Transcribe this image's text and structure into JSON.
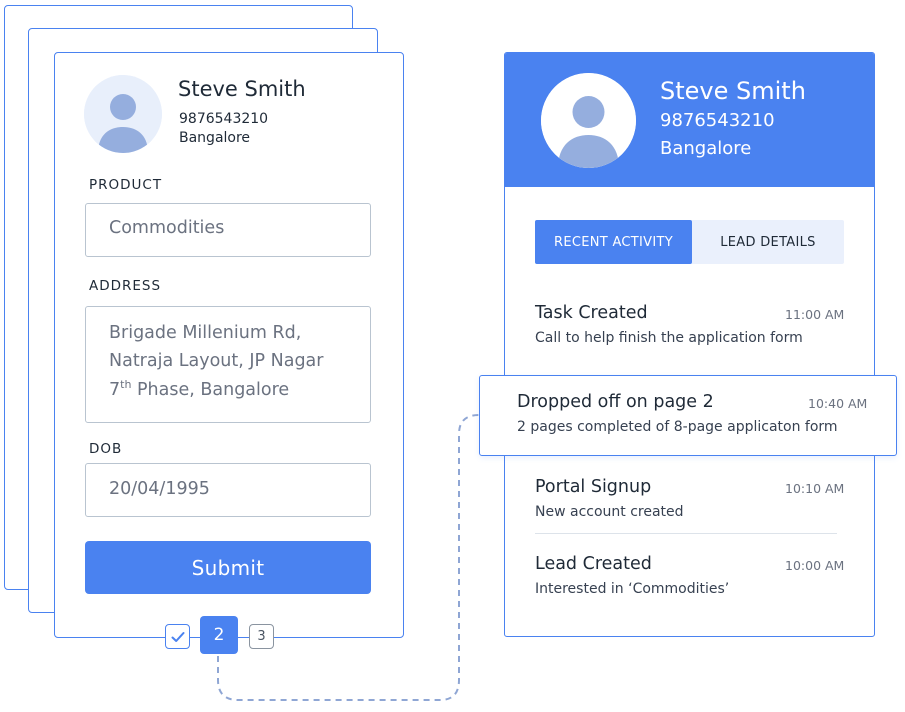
{
  "form": {
    "name": "Steve Smith",
    "phone": "9876543210",
    "city": "Bangalore",
    "product_label": "PRODUCT",
    "product_value": "Commodities",
    "address_label": "ADDRESS",
    "address_lines": [
      "Brigade Millenium Rd,",
      "Natraja Layout, JP Nagar"
    ],
    "address_line3_prefix": "7",
    "address_line3_sup": "th",
    "address_line3_suffix": " Phase, Bangalore",
    "dob_label": "DOB",
    "dob_value": "20/04/1995",
    "submit_label": "Submit"
  },
  "steps": {
    "done_icon": "check-icon",
    "current": "2",
    "next": "3"
  },
  "profile": {
    "name": "Steve Smith",
    "phone": "9876543210",
    "city": "Bangalore",
    "tabs": [
      {
        "label": "RECENT ACTIVITY",
        "active": true
      },
      {
        "label": "LEAD DETAILS",
        "active": false
      }
    ],
    "activities": [
      {
        "title": "Task Created",
        "time": "11:00 AM",
        "desc": "Call to help finish the application form"
      },
      {
        "title": "Dropped off on page 2",
        "time": "10:40 AM",
        "desc": "2 pages completed of 8-page applicaton form"
      },
      {
        "title": "Portal Signup",
        "time": "10:10 AM",
        "desc": "New account created"
      },
      {
        "title": "Lead Created",
        "time": "10:00 AM",
        "desc": "Interested in ‘Commodities’"
      }
    ]
  },
  "colors": {
    "accent": "#4a82f0",
    "avatar_fill": "#95aede",
    "avatar_bg": "#e8effb",
    "connector": "#8fa6d4"
  }
}
